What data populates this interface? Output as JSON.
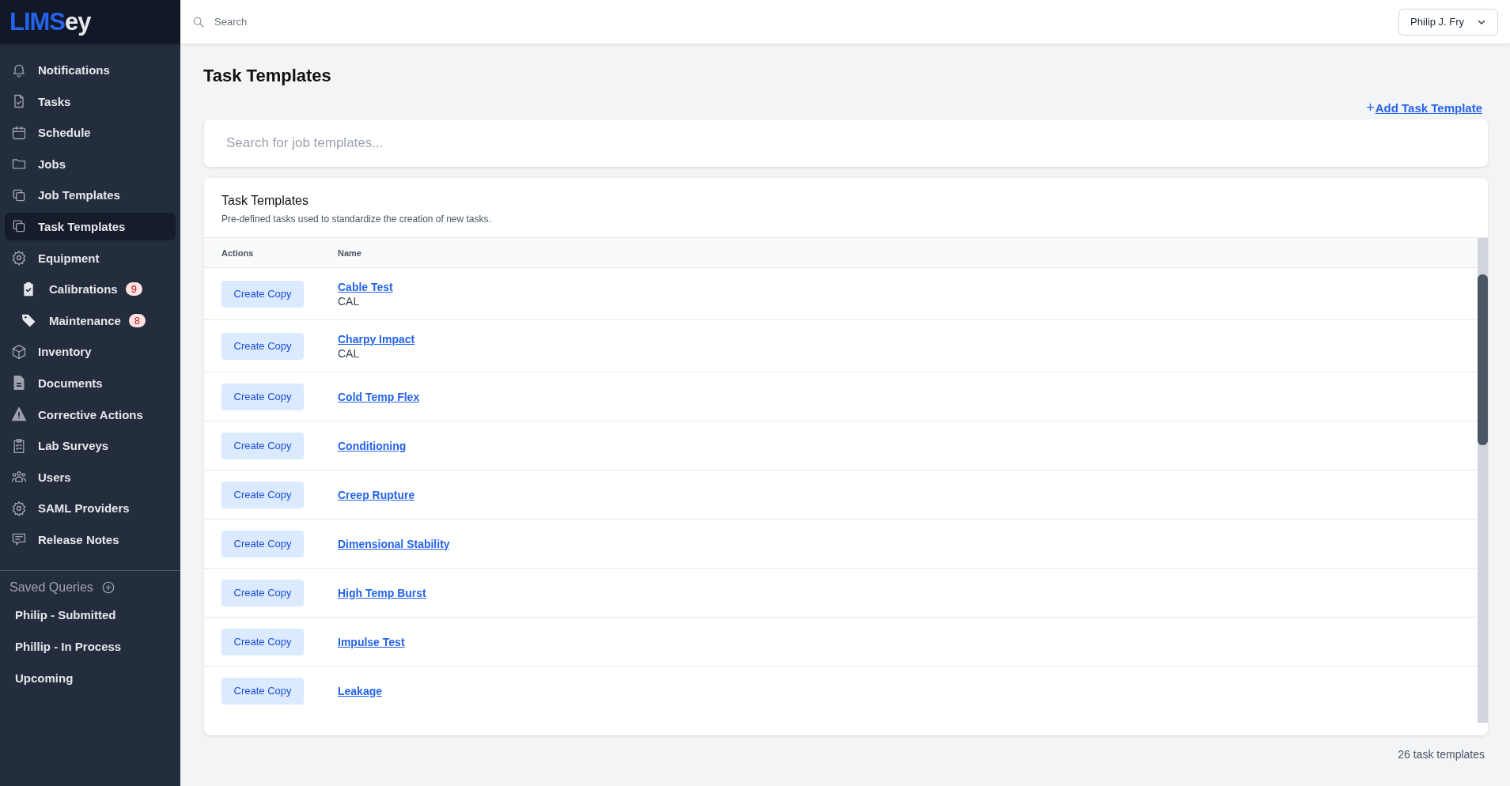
{
  "sidebar": {
    "logo": {
      "part_1": "LIMS",
      "part_2": "ey"
    },
    "items": [
      {
        "label": "Notifications",
        "selected": false
      },
      {
        "label": "Tasks",
        "selected": false
      },
      {
        "label": "Schedule",
        "selected": false
      },
      {
        "label": "Jobs",
        "selected": false
      },
      {
        "label": "Job Templates",
        "selected": false
      },
      {
        "label": "Task Templates",
        "selected": true
      },
      {
        "label": "Equipment",
        "selected": false,
        "children": [
          {
            "label": "Calibrations",
            "badge": "9",
            "selected": false
          },
          {
            "label": "Maintenance",
            "badge": "8",
            "selected": false
          }
        ]
      },
      {
        "label": "Inventory",
        "selected": false
      },
      {
        "label": "Documents",
        "selected": false
      },
      {
        "label": "Corrective Actions",
        "selected": false
      },
      {
        "label": "Lab Surveys",
        "selected": false
      },
      {
        "label": "Users",
        "selected": false
      },
      {
        "label": "SAML Providers",
        "selected": false
      },
      {
        "label": "Release Notes",
        "selected": false
      }
    ],
    "saved_queries": {
      "title": "Saved Queries",
      "items": [
        "Philip - Submitted",
        "Phillip - In Process",
        "Upcoming"
      ]
    }
  },
  "topbar": {
    "search": {
      "placeholder": "Search"
    },
    "user_menu": "Philip J. Fry"
  },
  "page": {
    "title": "Task Templates",
    "add_link": "Add Task Template",
    "add_link_icon": "+",
    "search": {
      "placeholder": "Search for job templates..."
    },
    "card": {
      "title": "Task Templates",
      "subtitle": "Pre-defined tasks used to standardize the creation of new tasks."
    },
    "table": {
      "columns": [
        "Actions",
        "Name"
      ],
      "rows": [
        {
          "action": "Create Copy",
          "name": "Cable Test",
          "category": "CAL"
        },
        {
          "action": "Create Copy",
          "name": "Charpy Impact",
          "category": "CAL"
        },
        {
          "action": "Create Copy",
          "name": "Cold Temp Flex"
        },
        {
          "action": "Create Copy",
          "name": "Conditioning"
        },
        {
          "action": "Create Copy",
          "name": "Creep Rupture"
        },
        {
          "action": "Create Copy",
          "name": "Dimensional Stability"
        },
        {
          "action": "Create Copy",
          "name": "High Temp Burst"
        },
        {
          "action": "Create Copy",
          "name": "Impulse Test"
        },
        {
          "action": "Create Copy",
          "name": "Leakage"
        }
      ]
    },
    "count": "26 task templates"
  }
}
